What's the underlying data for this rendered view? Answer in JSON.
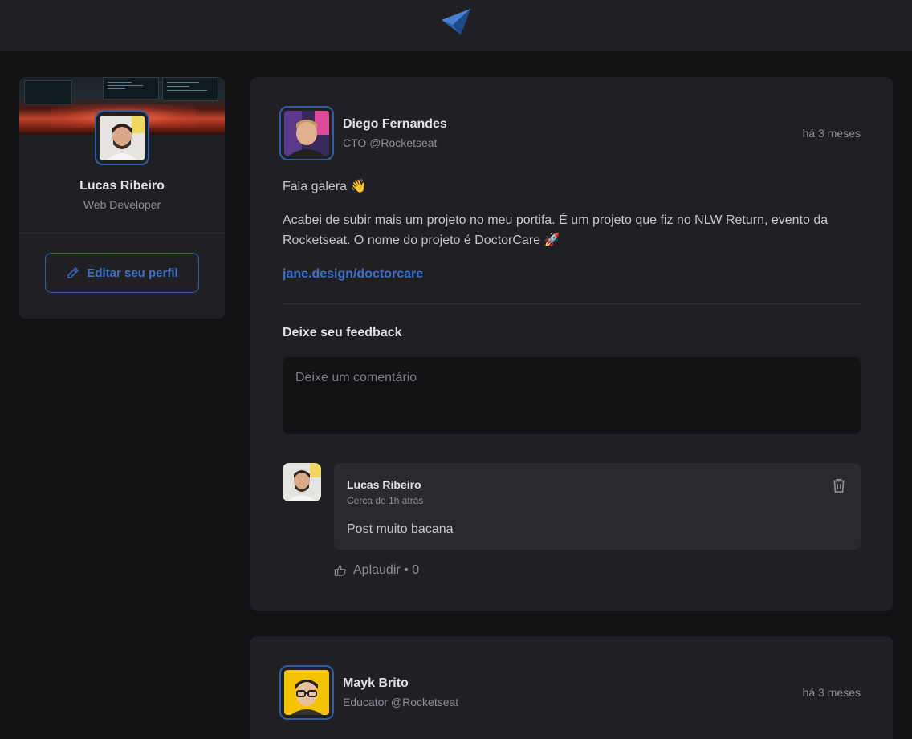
{
  "app": {
    "logo_icon": "ignite-logo-icon",
    "accent_color": "#2e5ea8",
    "link_color": "#3a70c9"
  },
  "sidebar": {
    "user_name": "Lucas Ribeiro",
    "user_role": "Web Developer",
    "edit_button_label": "Editar seu perfil",
    "edit_icon": "pencil-icon"
  },
  "posts": [
    {
      "author_name": "Diego Fernandes",
      "author_role": "CTO @Rocketseat",
      "time": "há 3 meses",
      "paragraphs": [
        "Fala galera 👋",
        "Acabei de subir mais um projeto no meu portifa. É um projeto que fiz no NLW Return, evento da Rocketseat. O nome do projeto é DoctorCare 🚀"
      ],
      "link": "jane.design/doctorcare",
      "feedback_title": "Deixe seu feedback",
      "comment_placeholder": "Deixe um comentário",
      "comments": [
        {
          "author_name": "Lucas Ribeiro",
          "time": "Cerca de 1h atrás",
          "text": "Post muito bacana",
          "applaud_label": "Aplaudir • 0",
          "delete_icon": "trash-icon",
          "applaud_icon": "thumbs-up-icon"
        }
      ]
    },
    {
      "author_name": "Mayk Brito",
      "author_role": "Educator @Rocketseat",
      "time": "há 3 meses"
    }
  ]
}
